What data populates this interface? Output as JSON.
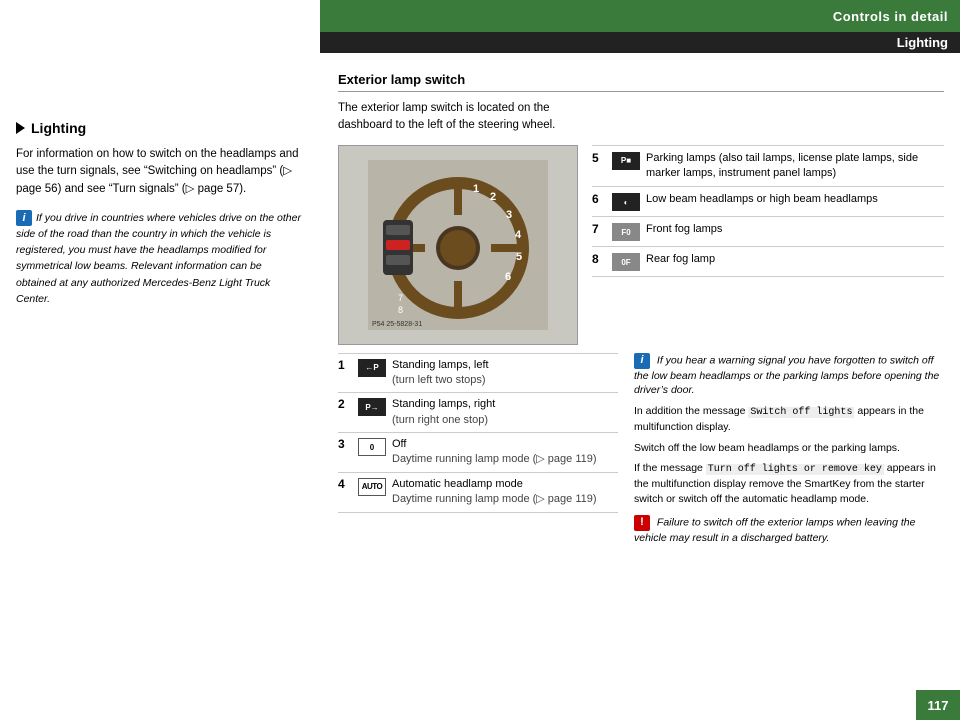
{
  "header": {
    "section_title": "Controls in detail",
    "lighting_label": "Lighting",
    "page_number": "117"
  },
  "left_column": {
    "heading": "Lighting",
    "body_text": "For information on how to switch on the headlamps and use the turn signals, see “Switching on headlamps” (▷ page 56) and see “Turn signals” (▷ page 57).",
    "info_note": "If you drive in countries where vehicles drive on the other side of the road than the country in which the vehicle is registered, you must have the headlamps modified for symmetrical low beams. Relevant information can be obtained at any authorized Mercedes-Benz Light Truck Center."
  },
  "exterior_switch": {
    "heading": "Exterior lamp switch",
    "intro": "The exterior lamp switch is located on the dashboard to the left of the steering wheel.",
    "image_caption": "P54 25-5828-31"
  },
  "bottom_rows": [
    {
      "num": "1",
      "icon_label": "←P",
      "desc": "Standing lamps, left",
      "sub": "(turn left two stops)"
    },
    {
      "num": "2",
      "icon_label": "P→",
      "desc": "Standing lamps, right",
      "sub": "(turn right one stop)"
    },
    {
      "num": "3",
      "icon_label": "0",
      "icon_type": "zero",
      "desc": "Off",
      "sub2": "Daytime running lamp mode (▷ page 119)"
    },
    {
      "num": "4",
      "icon_label": "AUTO",
      "icon_type": "auto",
      "desc": "Automatic headlamp mode",
      "sub2": "Daytime running lamp mode (▷ page 119)"
    }
  ],
  "right_rows": [
    {
      "num": "5",
      "icon_label": "P■",
      "desc": "Parking lamps (also tail lamps, license plate lamps, side marker lamps, instrument panel lamps)"
    },
    {
      "num": "6",
      "icon_label": "◐",
      "desc": "Low beam headlamps or high beam headlamps"
    },
    {
      "num": "7",
      "icon_label": "F0",
      "desc": "Front fog lamps"
    },
    {
      "num": "8",
      "icon_label": "0F",
      "desc": "Rear fog lamp"
    }
  ],
  "notes": {
    "note1": "If you hear a warning signal you have forgotten to switch off the low beam headlamps or the parking lamps before opening the driver’s door.",
    "note2_prefix": "In addition the message ",
    "note2_code": "Switch off lights",
    "note2_suffix": " appears in the multifunction display.",
    "note3": "Switch off the low beam headlamps or the parking lamps.",
    "note4_prefix": "If the message ",
    "note4_code": "Turn off lights or remove key",
    "note4_suffix": " appears in the multifunction display remove the SmartKey from the starter switch or switch off the automatic headlamp mode.",
    "warning": "Failure to switch off the exterior lamps when leaving the vehicle may result in a discharged battery."
  }
}
